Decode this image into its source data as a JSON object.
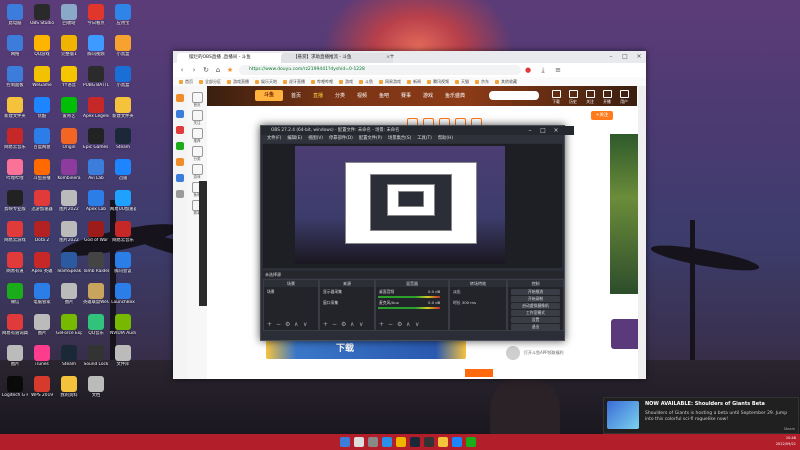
{
  "desktop": {
    "icons": [
      {
        "label": "此电脑",
        "color": "#3c7ddc"
      },
      {
        "label": "OBS Studio",
        "color": "#2a2a2a"
      },
      {
        "label": "回收站",
        "color": "#8aa8c8"
      },
      {
        "label": "今日看点",
        "color": "#e0362c"
      },
      {
        "label": "应用宝",
        "color": "#2f84e8"
      },
      {
        "label": "网络",
        "color": "#3c7ddc"
      },
      {
        "label": "QQ游戏",
        "color": "#ffb400"
      },
      {
        "label": "完整版1",
        "color": "#f0b400"
      },
      {
        "label": "腾讯视频",
        "color": "#3f9aff"
      },
      {
        "label": "小黑盒",
        "color": "#f7a130"
      },
      {
        "label": "控制面板",
        "color": "#3c7ddc"
      },
      {
        "label": "WeGame",
        "color": "#f2c100"
      },
      {
        "label": "YY语音",
        "color": "#f5c500"
      },
      {
        "label": "PUBG BATTLEGR",
        "color": "#2b2b2b"
      },
      {
        "label": "小黑盒",
        "color": "#1a6fd6"
      },
      {
        "label": "新建文件夹",
        "color": "#f5c33b"
      },
      {
        "label": "优酷",
        "color": "#1d85ff"
      },
      {
        "label": "爱奇艺",
        "color": "#00be06"
      },
      {
        "label": "Apex Legends",
        "color": "#c62828"
      },
      {
        "label": "新建文件夹",
        "color": "#f5c33b"
      },
      {
        "label": "网易云音乐",
        "color": "#c62828"
      },
      {
        "label": "百度网盘",
        "color": "#2b7de8"
      },
      {
        "label": "Origin",
        "color": "#f26522"
      },
      {
        "label": "Epic Games Launcher",
        "color": "#222"
      },
      {
        "label": "Steam",
        "color": "#1b2838"
      },
      {
        "label": "哔哩哔哩",
        "color": "#fb7299"
      },
      {
        "label": "斗鱼直播",
        "color": "#ff6a00"
      },
      {
        "label": "Kombinera",
        "color": "#8d3b9c"
      },
      {
        "label": "Avi Lab",
        "color": "#3c7ddc"
      },
      {
        "label": "迅雷",
        "color": "#1d85ff"
      },
      {
        "label": "剪映专业版",
        "color": "#222"
      },
      {
        "label": "迅游加速器",
        "color": "#e03a3a"
      },
      {
        "label": "图片2022",
        "color": "#bbb"
      },
      {
        "label": "Apex Lab",
        "color": "#2b7de8"
      },
      {
        "label": "网易UU加速器",
        "color": "#1fa1ff"
      },
      {
        "label": "网易云游戏",
        "color": "#e03a3a"
      },
      {
        "label": "Dota 2",
        "color": "#b22222"
      },
      {
        "label": "图片2022",
        "color": "#bbb"
      },
      {
        "label": "God of War",
        "color": "#9c1b1b"
      },
      {
        "label": "网易云音乐",
        "color": "#c62828"
      },
      {
        "label": "网易有道",
        "color": "#e03a3a"
      },
      {
        "label": "Apex 英雄",
        "color": "#c62828"
      },
      {
        "label": "TeamSpeak",
        "color": "#2c5aa0"
      },
      {
        "label": "Tomb Raider",
        "color": "#444"
      },
      {
        "label": "腾讯会议",
        "color": "#2b7de8"
      },
      {
        "label": "微信",
        "color": "#1aad19"
      },
      {
        "label": "电脑管家",
        "color": "#2b7de8"
      },
      {
        "label": "图片",
        "color": "#bbb"
      },
      {
        "label": "英雄联盟WeGame版",
        "color": "#c9a45c"
      },
      {
        "label": "LaunchBox",
        "color": "#2b7de8"
      },
      {
        "label": "网易有道词典",
        "color": "#e03a3a"
      },
      {
        "label": "图片",
        "color": "#bbb"
      },
      {
        "label": "GeForce Experience",
        "color": "#76b900"
      },
      {
        "label": "QQ音乐",
        "color": "#31c27c"
      },
      {
        "label": "NVIDIA Audio",
        "color": "#76b900"
      },
      {
        "label": "图片",
        "color": "#bbb"
      },
      {
        "label": "iTunes",
        "color": "#fc3c8d"
      },
      {
        "label": "Steam",
        "color": "#1b2838"
      },
      {
        "label": "Sound Lock",
        "color": "#333"
      },
      {
        "label": "文件库",
        "color": "#bbb"
      },
      {
        "label": "Logitech G HUB",
        "color": "#0a0a0a"
      },
      {
        "label": "WPS 2019",
        "color": "#d63a2d"
      },
      {
        "label": "我的资料",
        "color": "#f5c33b"
      },
      {
        "label": "文档",
        "color": "#bbb"
      }
    ]
  },
  "browser": {
    "tabs": [
      {
        "title": "摆烂的OBS直播 ,直播间 - 斗鱼"
      },
      {
        "title": "【悬赏】求助直播推流 - 斗鱼"
      }
    ],
    "url": "https://www.douyu.com/rz2199441?dyshid=0-1228",
    "bookmarks": [
      "首页",
      "全部分区",
      "游戏直播",
      "娱乐天地",
      "虎牙直播",
      "哔哩哔哩",
      "游戏",
      "斗鱼",
      "网易游戏",
      "新闻",
      "腾讯视频",
      "天猫",
      "京东",
      "其他收藏"
    ],
    "site": {
      "logo": "斗鱼",
      "nav": [
        "首页",
        "直播",
        "分类",
        "视频",
        "鱼吧",
        "赛事",
        "游戏",
        "鱼乐盛典"
      ],
      "header_icons": [
        "下载",
        "历史",
        "关注",
        "开播",
        "用户"
      ],
      "follow_label": "+关注",
      "banner_text": "下载",
      "comment_text": "打开斗鱼APP领取福利"
    },
    "sidepanel": [
      "首页",
      "关注",
      "推荐",
      "分类",
      "游戏",
      "鱼吧",
      "赛事"
    ]
  },
  "obs": {
    "title": "OBS 27.2.4 (64-bit, windows) - 配置文件: 未命名 - 场景: 未命名",
    "menu": [
      "文件(F)",
      "编辑(E)",
      "视图(V)",
      "停靠部件(D)",
      "配置文件(P)",
      "场景集合(S)",
      "工具(T)",
      "帮助(H)"
    ],
    "scene_label": "未选择源",
    "docks": [
      {
        "title": "场景",
        "rows": [
          "场景"
        ]
      },
      {
        "title": "来源",
        "rows": [
          "显示器采集",
          "窗口采集"
        ]
      },
      {
        "title": "混音器",
        "rows": [
          "桌面音频",
          "麦克风/Aux"
        ]
      },
      {
        "title": "转场特效",
        "rows": [
          "淡出",
          "时长 300 ms"
        ]
      },
      {
        "title": "控制",
        "rows": [
          "开始推流",
          "开始录制",
          "启动虚拟摄像机",
          "工作室模式",
          "设置",
          "退出"
        ]
      }
    ],
    "mixer_values": [
      "0.0 dB",
      "0.0 dB"
    ]
  },
  "notification": {
    "title": "NOW AVAILABLE: Shoulders of Giants Beta",
    "body": "Shoulders of Giants is hosting a beta until September 29. Jump into this colorful sci-fi roguelike now!",
    "app": "Steam"
  },
  "taskbar": {
    "apps": [
      "windows",
      "search",
      "taskview",
      "edge",
      "chrome",
      "steam",
      "obs",
      "explorer",
      "qq",
      "wechat"
    ],
    "clock": "10:48",
    "date": "2022/09/21"
  }
}
